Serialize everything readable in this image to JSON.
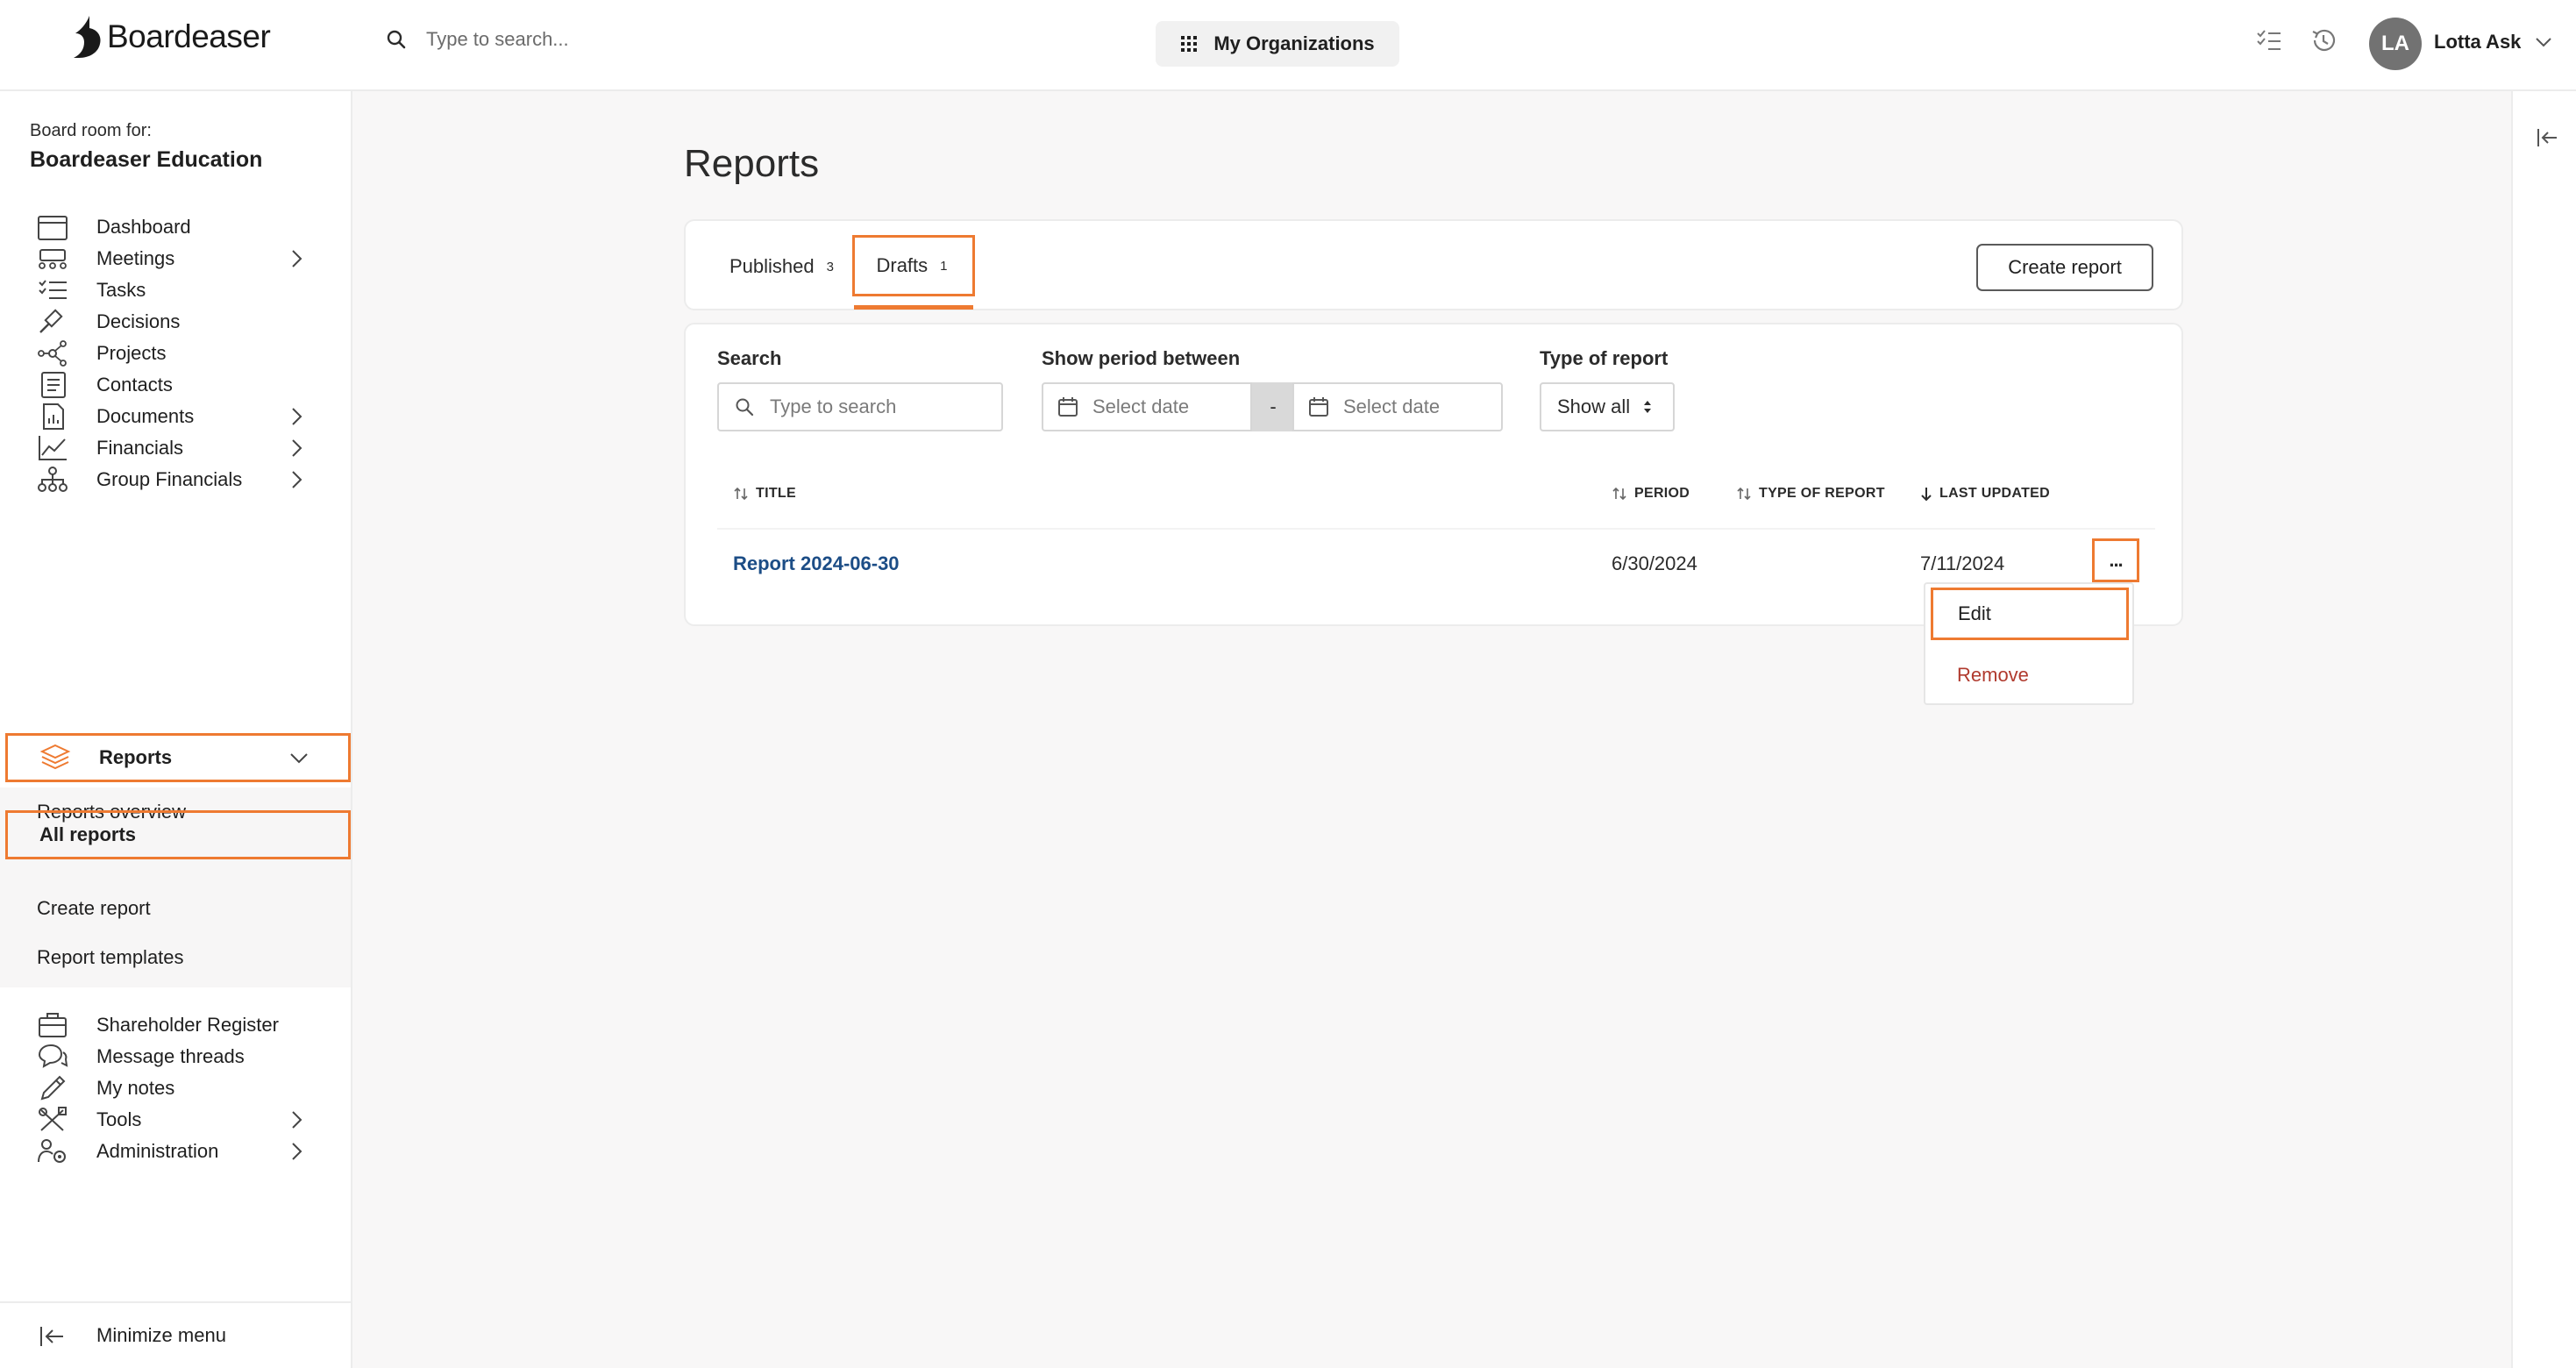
{
  "app": {
    "brand": "Boardeaser",
    "search_placeholder": "Type to search...",
    "my_orgs": "My Organizations",
    "user": {
      "initials": "LA",
      "name": "Lotta Ask"
    }
  },
  "sidebar": {
    "board_for": "Board room for:",
    "board_name": "Boardeaser Education",
    "items": [
      {
        "label": "Dashboard",
        "icon": "calendar-icon"
      },
      {
        "label": "Meetings",
        "icon": "meeting-icon"
      },
      {
        "label": "Tasks",
        "icon": "tasks-icon"
      },
      {
        "label": "Decisions",
        "icon": "gavel-icon"
      },
      {
        "label": "Projects",
        "icon": "network-icon"
      },
      {
        "label": "Contacts",
        "icon": "contacts-icon"
      },
      {
        "label": "Documents",
        "icon": "document-icon"
      },
      {
        "label": "Financials",
        "icon": "line-chart-icon"
      },
      {
        "label": "Group Financials",
        "icon": "hierarchy-icon"
      },
      {
        "label": "Reports",
        "icon": "layers-icon"
      },
      {
        "label": "Shareholder Register",
        "icon": "briefcase-icon"
      },
      {
        "label": "Message threads",
        "icon": "chat-icon"
      },
      {
        "label": "My notes",
        "icon": "pencil-icon"
      },
      {
        "label": "Tools",
        "icon": "tools-icon"
      },
      {
        "label": "Administration",
        "icon": "users-gear-icon"
      }
    ],
    "reports_sub": [
      "Reports overview",
      "All reports",
      "Create report",
      "Report templates"
    ],
    "minimize": "Minimize menu"
  },
  "main": {
    "title": "Reports",
    "tabs": [
      {
        "label": "Published",
        "count": "3"
      },
      {
        "label": "Drafts",
        "count": "1"
      }
    ],
    "create_button": "Create report",
    "filters": {
      "search_label": "Search",
      "search_placeholder": "Type to search",
      "period_label": "Show period between",
      "date_placeholder": "Select date",
      "separator": "-",
      "type_label": "Type of report",
      "type_value": "Show all"
    },
    "columns": [
      "TITLE",
      "PERIOD",
      "TYPE OF REPORT",
      "LAST UPDATED"
    ],
    "rows": [
      {
        "title": "Report 2024-06-30",
        "period": "6/30/2024",
        "type": "",
        "last_updated": "7/11/2024",
        "menu": "..."
      }
    ],
    "row_menu": {
      "edit": "Edit",
      "remove": "Remove"
    }
  },
  "colors": {
    "accent": "#ee7a31",
    "link": "#1c4d86",
    "danger": "#b03a2e"
  }
}
